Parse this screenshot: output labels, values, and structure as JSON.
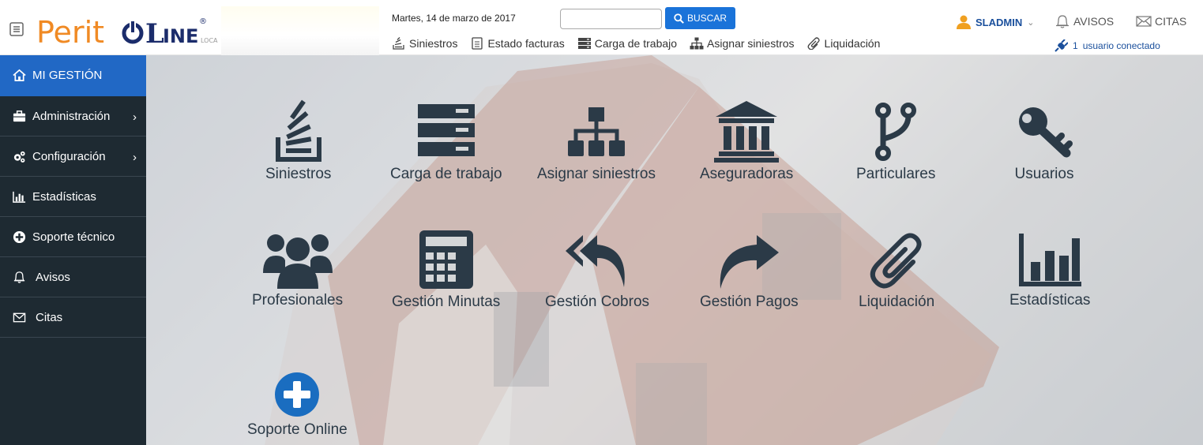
{
  "header": {
    "logo_text": "Perito LINE",
    "logo_suffix": "LOCAL",
    "date": "Martes, 14 de marzo de 2017",
    "search_placeholder": "",
    "search_button": "BUSCAR",
    "nav": [
      {
        "label": "Siniestros",
        "icon": "stack-icon"
      },
      {
        "label": "Estado facturas",
        "icon": "document-icon"
      },
      {
        "label": "Carga de trabajo",
        "icon": "server-icon"
      },
      {
        "label": "Asignar siniestros",
        "icon": "sitemap-icon"
      },
      {
        "label": "Liquidación",
        "icon": "paperclip-icon"
      }
    ],
    "user": "SLADMIN",
    "avisos": "AVISOS",
    "citas": "CITAS",
    "connected_count": "1",
    "connected_text": "usuario conectado"
  },
  "sidebar": {
    "items": [
      {
        "label": "MI GESTIÓN",
        "icon": "home-icon",
        "active": true
      },
      {
        "label": "Administración",
        "icon": "briefcase-icon",
        "submenu": true
      },
      {
        "label": "Configuración",
        "icon": "gears-icon",
        "submenu": true
      },
      {
        "label": "Estadísticas",
        "icon": "bar-chart-icon"
      },
      {
        "label": "Soporte técnico",
        "icon": "plus-circle-icon"
      },
      {
        "label": "Avisos",
        "icon": "bell-icon"
      },
      {
        "label": "Citas",
        "icon": "envelope-icon"
      }
    ]
  },
  "tiles": [
    {
      "label": "Siniestros",
      "icon": "stack-overflow-icon"
    },
    {
      "label": "Carga de trabajo",
      "icon": "server-icon"
    },
    {
      "label": "Asignar siniestros",
      "icon": "sitemap-icon"
    },
    {
      "label": "Aseguradoras",
      "icon": "bank-icon"
    },
    {
      "label": "Particulares",
      "icon": "code-fork-icon"
    },
    {
      "label": "Usuarios",
      "icon": "key-icon"
    },
    {
      "label": "Profesionales",
      "icon": "users-icon"
    },
    {
      "label": "Gestión Minutas",
      "icon": "calculator-icon"
    },
    {
      "label": "Gestión Cobros",
      "icon": "reply-all-icon"
    },
    {
      "label": "Gestión Pagos",
      "icon": "share-icon"
    },
    {
      "label": "Liquidación",
      "icon": "paperclip-icon"
    },
    {
      "label": "Estadísticas",
      "icon": "bar-chart-icon"
    },
    {
      "label": "Soporte Online",
      "icon": "plus-circle-icon"
    }
  ],
  "colors": {
    "sidebar_bg": "#1e2a32",
    "active": "#2168c5",
    "accent_orange": "#f08a24",
    "brand_navy": "#1b2c6b",
    "search_button": "#1a73d9",
    "tile_icon": "#2b3a47",
    "soporte_circle": "#1a6dc0"
  }
}
